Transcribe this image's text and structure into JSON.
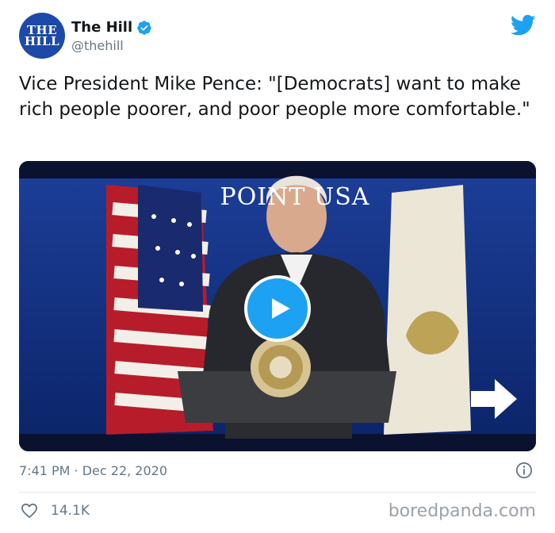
{
  "account": {
    "avatar_line1": "THE",
    "avatar_line2": "HILL",
    "display_name": "The Hill",
    "handle": "@thehill",
    "verified": true,
    "brand_color": "#1d4aa8"
  },
  "tweet": {
    "text": "Vice President Mike Pence: \"[Democrats] want to make rich people poorer, and poor people more comfortable.\"",
    "time": "7:41 PM · Dec 22, 2020",
    "likes": "14.1K"
  },
  "media": {
    "type": "video",
    "banner_text": "POINT USA",
    "play_icon": "play-icon"
  },
  "icons": {
    "twitter": "twitter-bird-icon",
    "verified": "verified-badge-icon",
    "info": "info-icon",
    "like": "heart-icon"
  },
  "colors": {
    "twitter_blue": "#1da1f2",
    "text_secondary": "#657786",
    "divider": "#e1e8ed"
  },
  "watermark": "boredpanda.com"
}
